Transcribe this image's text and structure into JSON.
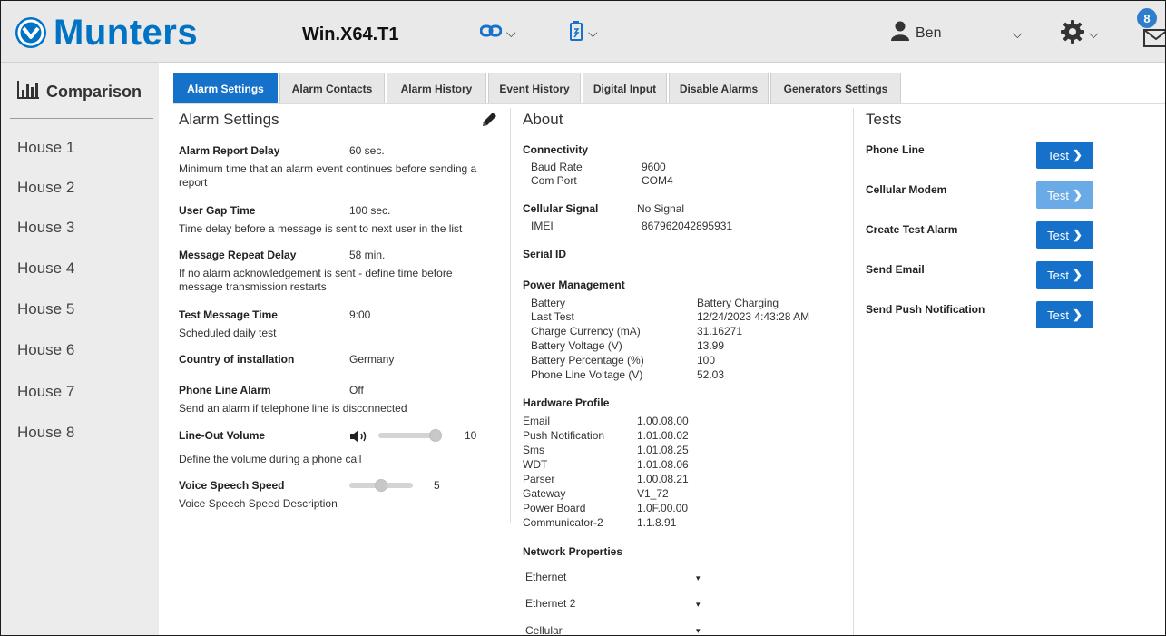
{
  "header": {
    "brand": "Munters",
    "device_name": "Win.X64.T1",
    "user_name": "Ben",
    "notification_count": "8",
    "icons": [
      "munters-logo-icon",
      "link-icon",
      "device-icon",
      "user-icon",
      "gear-icon",
      "mail-icon"
    ]
  },
  "sidebar": {
    "comparison_label": "Comparison",
    "houses": [
      "House 1",
      "House 2",
      "House 3",
      "House 4",
      "House 5",
      "House 6",
      "House 7",
      "House 8"
    ]
  },
  "tabs": [
    {
      "label": "Alarm Settings",
      "active": true
    },
    {
      "label": "Alarm Contacts",
      "active": false
    },
    {
      "label": "Alarm History",
      "active": false
    },
    {
      "label": "Event History",
      "active": false
    },
    {
      "label": "Digital Input",
      "active": false
    },
    {
      "label": "Disable Alarms",
      "active": false
    },
    {
      "label": "Generators Settings",
      "active": false
    }
  ],
  "alarm_settings": {
    "title": "Alarm Settings",
    "items": [
      {
        "label": "Alarm Report Delay",
        "value": "60 sec.",
        "desc": "Minimum time that an alarm event continues before sending a report"
      },
      {
        "label": "User Gap Time",
        "value": "100 sec.",
        "desc": "Time delay before a message is sent to next user in the list"
      },
      {
        "label": "Message Repeat Delay",
        "value": "58 min.",
        "desc": "If no alarm acknowledgement is sent - define time before message transmission restarts"
      },
      {
        "label": "Test Message Time",
        "value": "9:00",
        "desc": "Scheduled daily test"
      },
      {
        "label": "Country of installation",
        "value": "Germany",
        "desc": ""
      },
      {
        "label": "Phone Line Alarm",
        "value": "Off",
        "desc": "Send an alarm if telephone line is disconnected"
      },
      {
        "label": "Line-Out Volume",
        "value": "10",
        "desc": "Define the volume during a phone call",
        "level": 1.0
      },
      {
        "label": "Voice Speech Speed",
        "value": "5",
        "desc": "Voice Speech Speed Description",
        "level": 0.5
      }
    ]
  },
  "about": {
    "title": "About",
    "connectivity": {
      "heading": "Connectivity",
      "rows": [
        {
          "k": "Baud Rate",
          "v": "9600"
        },
        {
          "k": "Com Port",
          "v": "COM4"
        }
      ]
    },
    "cellular": {
      "heading": "Cellular Signal",
      "status": "No Signal",
      "rows": [
        {
          "k": "IMEI",
          "v": "867962042895931"
        }
      ]
    },
    "serial_heading": "Serial ID",
    "power": {
      "heading": "Power Management",
      "rows": [
        {
          "k": "Battery",
          "v": "Battery Charging"
        },
        {
          "k": "Last Test",
          "v": "12/24/2023 4:43:28 AM"
        },
        {
          "k": "Charge Currency (mA)",
          "v": "31.16271"
        },
        {
          "k": "Battery Voltage (V)",
          "v": "13.99"
        },
        {
          "k": "Battery Percentage (%)",
          "v": "100"
        },
        {
          "k": "Phone Line Voltage (V)",
          "v": "52.03"
        }
      ]
    },
    "hardware": {
      "heading": "Hardware Profile",
      "rows": [
        {
          "k": "Email",
          "v": "1.00.08.00"
        },
        {
          "k": "Push Notification",
          "v": "1.01.08.02"
        },
        {
          "k": "Sms",
          "v": "1.01.08.25"
        },
        {
          "k": "WDT",
          "v": "1.01.08.06"
        },
        {
          "k": "Parser",
          "v": "1.00.08.21"
        },
        {
          "k": "Gateway",
          "v": "V1_72"
        },
        {
          "k": "Power Board",
          "v": "1.0F.00.00"
        },
        {
          "k": "Communicator-2",
          "v": "1.1.8.91"
        }
      ]
    },
    "network": {
      "heading": "Network Properties",
      "items": [
        "Ethernet",
        "Ethernet 2",
        "Cellular"
      ],
      "arrow": "▾"
    }
  },
  "tests": {
    "title": "Tests",
    "button_label": "Test",
    "items": [
      {
        "label": "Phone Line",
        "enabled": true
      },
      {
        "label": "Cellular Modem",
        "enabled": false
      },
      {
        "label": "Create Test Alarm",
        "enabled": true
      },
      {
        "label": "Send Email",
        "enabled": true
      },
      {
        "label": "Send Push Notification",
        "enabled": true
      }
    ]
  },
  "colors": {
    "brand": "#0073c4",
    "accent": "#1571c9",
    "disabled": "#6aaae6"
  }
}
